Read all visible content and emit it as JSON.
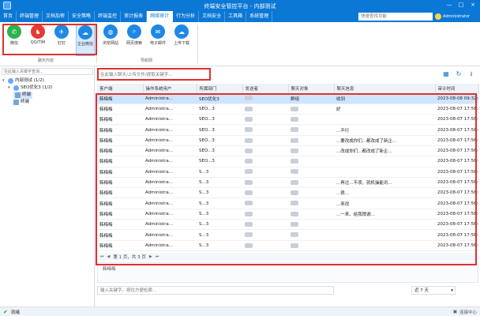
{
  "titlebar": {
    "title": "终端安全管控平台 - 内部测试",
    "min": "—",
    "max": "□",
    "close": "×"
  },
  "menu": [
    {
      "label": "首页"
    },
    {
      "label": "终端管理"
    },
    {
      "label": "文档加密"
    },
    {
      "label": "安全策略"
    },
    {
      "label": "终端监控"
    },
    {
      "label": "审计报表"
    },
    {
      "label": "网络审计",
      "active": true
    },
    {
      "label": "行为分析"
    },
    {
      "label": "文档安全"
    },
    {
      "label": "工具箱"
    },
    {
      "label": "系统管理"
    }
  ],
  "menu_search_placeholder": "快速查找功能",
  "user_name": "Administrator",
  "ribbon": {
    "chat_group_label": "聊天内容",
    "nav_group_label": "导航网",
    "chat_buttons": [
      {
        "label": "微信",
        "icon": "wechat-icon",
        "color": "#2bb24c",
        "glyph": "✆"
      },
      {
        "label": "QQ/TIM",
        "icon": "qq-icon",
        "color": "#e53935",
        "glyph": "♞"
      },
      {
        "label": "钉钉",
        "icon": "dingtalk-icon",
        "color": "#1e88e5",
        "glyph": "✈"
      },
      {
        "label": "企业微信",
        "icon": "wecom-icon",
        "color": "#1e88e5",
        "glyph": "☁",
        "selected": true
      }
    ],
    "nav_buttons": [
      {
        "label": "浏览网站",
        "icon": "globe-icon",
        "color": "#1e88e5",
        "glyph": "◍"
      },
      {
        "label": "网页搜索",
        "icon": "web-search-icon",
        "color": "#1e88e5",
        "glyph": "⌕"
      },
      {
        "label": "电子邮件",
        "icon": "email-icon",
        "color": "#1e88e5",
        "glyph": "✉"
      },
      {
        "label": "上传下载",
        "icon": "cloud-transfer-icon",
        "color": "#1e88e5",
        "glyph": "☁"
      }
    ]
  },
  "left": {
    "search_placeholder": "在此输入关键字查询...",
    "tree": [
      {
        "label": "内部测试 (1/2)",
        "level": 0,
        "kind": "group"
      },
      {
        "label": "SEO优化3 (1/2)",
        "level": 1,
        "kind": "group"
      },
      {
        "label": "终端",
        "level": 2,
        "kind": "pc",
        "selected": true
      },
      {
        "label": "终端",
        "level": 2,
        "kind": "pc"
      }
    ]
  },
  "main": {
    "search_placeholder": "在此输入聊天/上传文件/提取关键字...",
    "tools": {
      "grid": "▦",
      "refresh": "↻",
      "export": "⭳"
    },
    "columns": [
      "客户端",
      "操作系统用户",
      "所属部门",
      "发送者",
      "聊天对象",
      "聊天信息",
      "审计时间"
    ],
    "rows": [
      [
        "韩梅梅",
        "Administra...",
        "SEO优化3",
        "",
        "群组",
        "收到",
        "2023-08-08 09:32:00"
      ],
      [
        "韩梅梅",
        "Administra...",
        "SEO...3",
        "",
        "",
        "好",
        "2023-08-07 17:56:00"
      ],
      [
        "韩梅梅",
        "Administra...",
        "SEO...3",
        "",
        "",
        "",
        "2023-08-07 17:56:00"
      ],
      [
        "韩梅梅",
        "Administra...",
        "SEO...3",
        "",
        "",
        "...不行",
        "2023-08-07 17:56:00"
      ],
      [
        "韩梅梅",
        "Administra...",
        "SEO...3",
        "",
        "",
        "...要改成你们...都改成了新企...",
        "2023-08-07 17:56:00"
      ],
      [
        "韩梅梅",
        "Administra...",
        "SEO...3",
        "",
        "",
        "...改成你们...都改成了新企...",
        "2023-08-07 17:56:00"
      ],
      [
        "韩梅梅",
        "Administra...",
        "SEO...3",
        "",
        "",
        "",
        "2023-08-07 17:56:00"
      ],
      [
        "韩梅梅",
        "Administra...",
        "S...3",
        "",
        "",
        "",
        "2023-08-07 17:56:00"
      ],
      [
        "韩梅梅",
        "Administra...",
        "S...3",
        "",
        "",
        "...再过...不须，就机操能讯...",
        "2023-08-07 17:56:00"
      ],
      [
        "韩梅梅",
        "Administra...",
        "S...3",
        "",
        "",
        "...很...",
        "2023-08-07 17:56:00"
      ],
      [
        "韩梅梅",
        "Administra...",
        "S...3",
        "",
        "",
        "...来改",
        "2023-08-07 17:56:00"
      ],
      [
        "韩梅梅",
        "Administra...",
        "S...3",
        "",
        "",
        "...一来，给我稍谢...",
        "2023-08-07 17:56:00"
      ],
      [
        "韩梅梅",
        "Administra...",
        "S...3",
        "",
        "",
        "",
        "2023-08-07 17:56:00"
      ],
      [
        "韩梅梅",
        "Administra...",
        "S...3",
        "",
        "",
        "",
        "2023-08-07 17:56:00"
      ],
      [
        "韩梅梅",
        "Administra...",
        "S...3",
        "",
        "",
        "",
        "2023-08-07 17:56:00"
      ]
    ],
    "pager": {
      "first": "⏮",
      "prev": "◀",
      "text": "第 1 页，共 3 页",
      "next": "▶",
      "last": "⏭"
    },
    "detail_sender": "韩梅梅",
    "keyword_placeholder": "输入关键字，按住方便检索...",
    "days_select": "近 7 天"
  },
  "status": {
    "left": "就绪",
    "right": "连接中心"
  }
}
